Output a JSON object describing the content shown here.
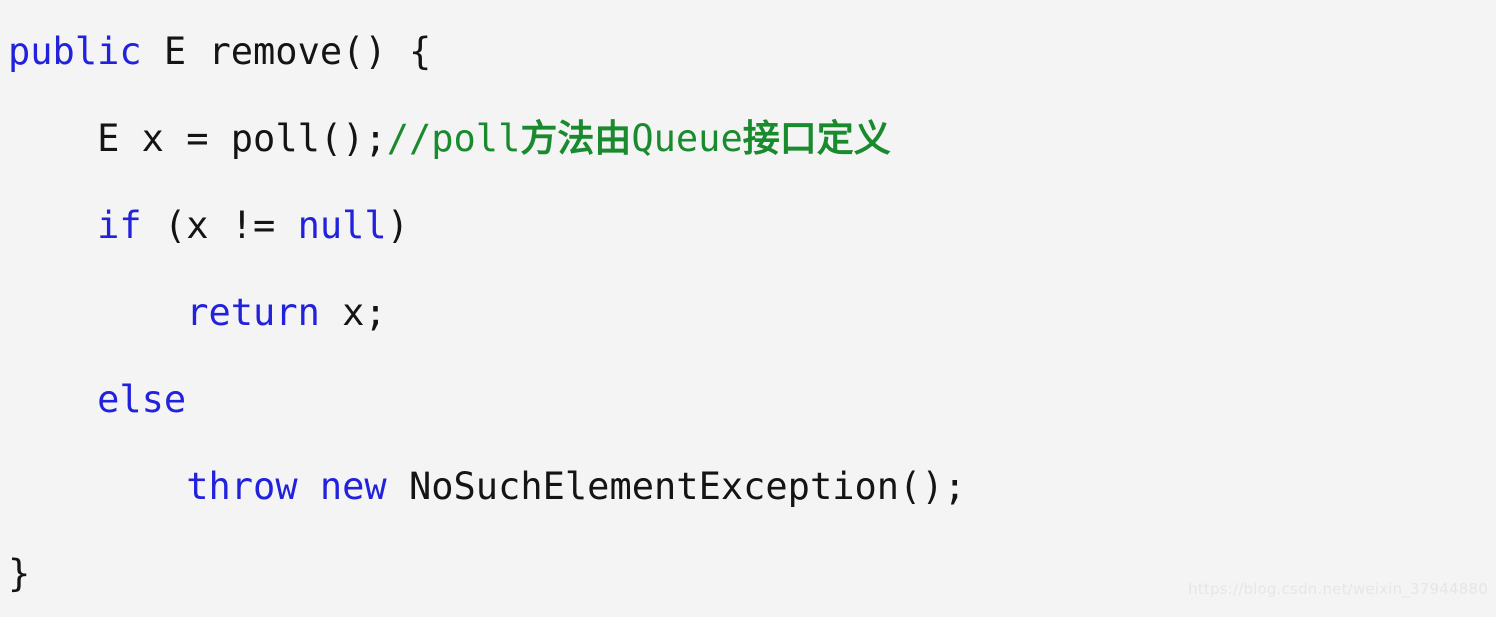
{
  "editor": {
    "language": "Java",
    "background_color": "#f4f4f4",
    "keyword_color": "#2222dd",
    "comment_color": "#1a8a2e",
    "plain_color": "#141414",
    "lines": [
      {
        "indent": 0,
        "tokens": [
          {
            "type": "keyword",
            "text": "public"
          },
          {
            "type": "plain",
            "text": " E remove() {"
          }
        ]
      },
      {
        "indent": 4,
        "tokens": [
          {
            "type": "plain",
            "text": "E x = poll();"
          },
          {
            "type": "comment",
            "text": "//poll方法由Queue接口定义"
          }
        ]
      },
      {
        "indent": 4,
        "tokens": [
          {
            "type": "keyword",
            "text": "if"
          },
          {
            "type": "plain",
            "text": " (x != "
          },
          {
            "type": "keyword",
            "text": "null"
          },
          {
            "type": "plain",
            "text": ")"
          }
        ]
      },
      {
        "indent": 8,
        "tokens": [
          {
            "type": "keyword",
            "text": "return"
          },
          {
            "type": "plain",
            "text": " x;"
          }
        ]
      },
      {
        "indent": 4,
        "tokens": [
          {
            "type": "keyword",
            "text": "else"
          }
        ]
      },
      {
        "indent": 8,
        "tokens": [
          {
            "type": "keyword",
            "text": "throw new"
          },
          {
            "type": "plain",
            "text": " NoSuchElementException();"
          }
        ]
      },
      {
        "indent": 0,
        "tokens": [
          {
            "type": "plain",
            "text": "}"
          }
        ]
      }
    ]
  },
  "watermark": {
    "text": "https://blog.csdn.net/weixin_37944880"
  }
}
